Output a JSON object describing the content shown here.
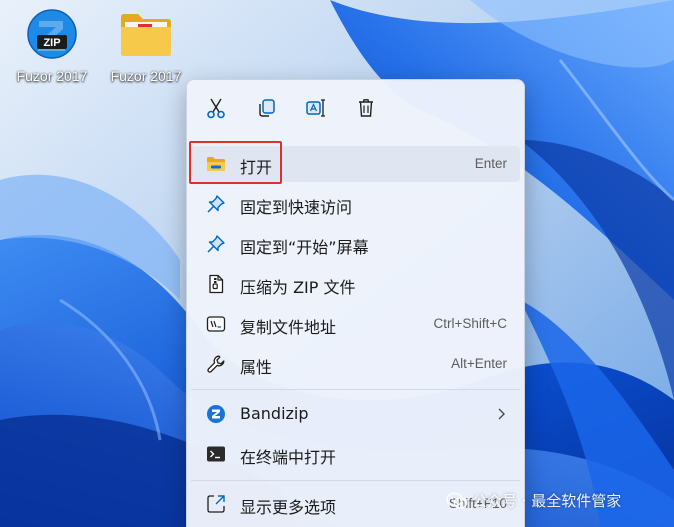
{
  "desktop": {
    "icons": [
      {
        "label": "Fuzor 2017",
        "badge": "ZIP",
        "icon": "bandizip-zip-icon"
      },
      {
        "label": "Fuzor 2017",
        "icon": "folder-icon"
      }
    ]
  },
  "menu": {
    "toolbar": [
      {
        "name": "cut",
        "icon": "scissors-icon"
      },
      {
        "name": "copy",
        "icon": "copy-icon"
      },
      {
        "name": "rename",
        "icon": "rename-icon"
      },
      {
        "name": "delete",
        "icon": "trash-icon"
      }
    ],
    "items": [
      {
        "label": "打开",
        "shortcut": "Enter",
        "icon": "folder-icon"
      },
      {
        "label": "固定到快速访问",
        "icon": "pin-icon"
      },
      {
        "label": "固定到“开始”屏幕",
        "icon": "pin-icon"
      },
      {
        "label": "压缩为 ZIP 文件",
        "icon": "zip-file-icon"
      },
      {
        "label": "复制文件地址",
        "shortcut": "Ctrl+Shift+C",
        "icon": "path-icon"
      },
      {
        "label": "属性",
        "shortcut": "Alt+Enter",
        "icon": "wrench-icon"
      },
      {
        "label": "Bandizip",
        "icon": "bandizip-icon",
        "submenu": true
      },
      {
        "label": "在终端中打开",
        "icon": "terminal-icon"
      },
      {
        "label": "显示更多选项",
        "shortcut": "Shift+F10",
        "icon": "more-options-icon"
      }
    ]
  },
  "watermark": {
    "text": "公众号 · 最全软件管家"
  },
  "colors": {
    "highlight_box": "#e0302b",
    "accent": "#0067c0",
    "folder": "#f4c542"
  }
}
